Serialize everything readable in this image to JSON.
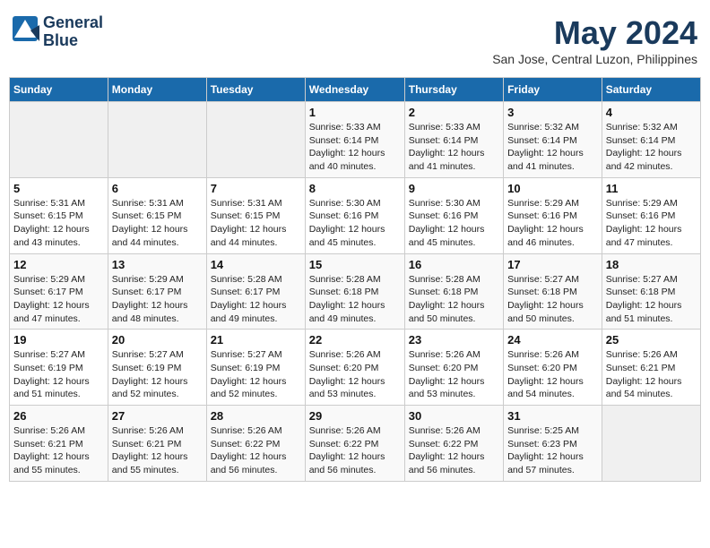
{
  "header": {
    "logo_line1": "General",
    "logo_line2": "Blue",
    "month": "May 2024",
    "location": "San Jose, Central Luzon, Philippines"
  },
  "weekdays": [
    "Sunday",
    "Monday",
    "Tuesday",
    "Wednesday",
    "Thursday",
    "Friday",
    "Saturday"
  ],
  "weeks": [
    [
      {
        "day": "",
        "sunrise": "",
        "sunset": "",
        "daylight": "",
        "empty": true
      },
      {
        "day": "",
        "sunrise": "",
        "sunset": "",
        "daylight": "",
        "empty": true
      },
      {
        "day": "",
        "sunrise": "",
        "sunset": "",
        "daylight": "",
        "empty": true
      },
      {
        "day": "1",
        "sunrise": "Sunrise: 5:33 AM",
        "sunset": "Sunset: 6:14 PM",
        "daylight": "Daylight: 12 hours and 40 minutes."
      },
      {
        "day": "2",
        "sunrise": "Sunrise: 5:33 AM",
        "sunset": "Sunset: 6:14 PM",
        "daylight": "Daylight: 12 hours and 41 minutes."
      },
      {
        "day": "3",
        "sunrise": "Sunrise: 5:32 AM",
        "sunset": "Sunset: 6:14 PM",
        "daylight": "Daylight: 12 hours and 41 minutes."
      },
      {
        "day": "4",
        "sunrise": "Sunrise: 5:32 AM",
        "sunset": "Sunset: 6:14 PM",
        "daylight": "Daylight: 12 hours and 42 minutes."
      }
    ],
    [
      {
        "day": "5",
        "sunrise": "Sunrise: 5:31 AM",
        "sunset": "Sunset: 6:15 PM",
        "daylight": "Daylight: 12 hours and 43 minutes."
      },
      {
        "day": "6",
        "sunrise": "Sunrise: 5:31 AM",
        "sunset": "Sunset: 6:15 PM",
        "daylight": "Daylight: 12 hours and 44 minutes."
      },
      {
        "day": "7",
        "sunrise": "Sunrise: 5:31 AM",
        "sunset": "Sunset: 6:15 PM",
        "daylight": "Daylight: 12 hours and 44 minutes."
      },
      {
        "day": "8",
        "sunrise": "Sunrise: 5:30 AM",
        "sunset": "Sunset: 6:16 PM",
        "daylight": "Daylight: 12 hours and 45 minutes."
      },
      {
        "day": "9",
        "sunrise": "Sunrise: 5:30 AM",
        "sunset": "Sunset: 6:16 PM",
        "daylight": "Daylight: 12 hours and 45 minutes."
      },
      {
        "day": "10",
        "sunrise": "Sunrise: 5:29 AM",
        "sunset": "Sunset: 6:16 PM",
        "daylight": "Daylight: 12 hours and 46 minutes."
      },
      {
        "day": "11",
        "sunrise": "Sunrise: 5:29 AM",
        "sunset": "Sunset: 6:16 PM",
        "daylight": "Daylight: 12 hours and 47 minutes."
      }
    ],
    [
      {
        "day": "12",
        "sunrise": "Sunrise: 5:29 AM",
        "sunset": "Sunset: 6:17 PM",
        "daylight": "Daylight: 12 hours and 47 minutes."
      },
      {
        "day": "13",
        "sunrise": "Sunrise: 5:29 AM",
        "sunset": "Sunset: 6:17 PM",
        "daylight": "Daylight: 12 hours and 48 minutes."
      },
      {
        "day": "14",
        "sunrise": "Sunrise: 5:28 AM",
        "sunset": "Sunset: 6:17 PM",
        "daylight": "Daylight: 12 hours and 49 minutes."
      },
      {
        "day": "15",
        "sunrise": "Sunrise: 5:28 AM",
        "sunset": "Sunset: 6:18 PM",
        "daylight": "Daylight: 12 hours and 49 minutes."
      },
      {
        "day": "16",
        "sunrise": "Sunrise: 5:28 AM",
        "sunset": "Sunset: 6:18 PM",
        "daylight": "Daylight: 12 hours and 50 minutes."
      },
      {
        "day": "17",
        "sunrise": "Sunrise: 5:27 AM",
        "sunset": "Sunset: 6:18 PM",
        "daylight": "Daylight: 12 hours and 50 minutes."
      },
      {
        "day": "18",
        "sunrise": "Sunrise: 5:27 AM",
        "sunset": "Sunset: 6:18 PM",
        "daylight": "Daylight: 12 hours and 51 minutes."
      }
    ],
    [
      {
        "day": "19",
        "sunrise": "Sunrise: 5:27 AM",
        "sunset": "Sunset: 6:19 PM",
        "daylight": "Daylight: 12 hours and 51 minutes."
      },
      {
        "day": "20",
        "sunrise": "Sunrise: 5:27 AM",
        "sunset": "Sunset: 6:19 PM",
        "daylight": "Daylight: 12 hours and 52 minutes."
      },
      {
        "day": "21",
        "sunrise": "Sunrise: 5:27 AM",
        "sunset": "Sunset: 6:19 PM",
        "daylight": "Daylight: 12 hours and 52 minutes."
      },
      {
        "day": "22",
        "sunrise": "Sunrise: 5:26 AM",
        "sunset": "Sunset: 6:20 PM",
        "daylight": "Daylight: 12 hours and 53 minutes."
      },
      {
        "day": "23",
        "sunrise": "Sunrise: 5:26 AM",
        "sunset": "Sunset: 6:20 PM",
        "daylight": "Daylight: 12 hours and 53 minutes."
      },
      {
        "day": "24",
        "sunrise": "Sunrise: 5:26 AM",
        "sunset": "Sunset: 6:20 PM",
        "daylight": "Daylight: 12 hours and 54 minutes."
      },
      {
        "day": "25",
        "sunrise": "Sunrise: 5:26 AM",
        "sunset": "Sunset: 6:21 PM",
        "daylight": "Daylight: 12 hours and 54 minutes."
      }
    ],
    [
      {
        "day": "26",
        "sunrise": "Sunrise: 5:26 AM",
        "sunset": "Sunset: 6:21 PM",
        "daylight": "Daylight: 12 hours and 55 minutes."
      },
      {
        "day": "27",
        "sunrise": "Sunrise: 5:26 AM",
        "sunset": "Sunset: 6:21 PM",
        "daylight": "Daylight: 12 hours and 55 minutes."
      },
      {
        "day": "28",
        "sunrise": "Sunrise: 5:26 AM",
        "sunset": "Sunset: 6:22 PM",
        "daylight": "Daylight: 12 hours and 56 minutes."
      },
      {
        "day": "29",
        "sunrise": "Sunrise: 5:26 AM",
        "sunset": "Sunset: 6:22 PM",
        "daylight": "Daylight: 12 hours and 56 minutes."
      },
      {
        "day": "30",
        "sunrise": "Sunrise: 5:26 AM",
        "sunset": "Sunset: 6:22 PM",
        "daylight": "Daylight: 12 hours and 56 minutes."
      },
      {
        "day": "31",
        "sunrise": "Sunrise: 5:25 AM",
        "sunset": "Sunset: 6:23 PM",
        "daylight": "Daylight: 12 hours and 57 minutes."
      },
      {
        "day": "",
        "sunrise": "",
        "sunset": "",
        "daylight": "",
        "empty": true
      }
    ]
  ]
}
